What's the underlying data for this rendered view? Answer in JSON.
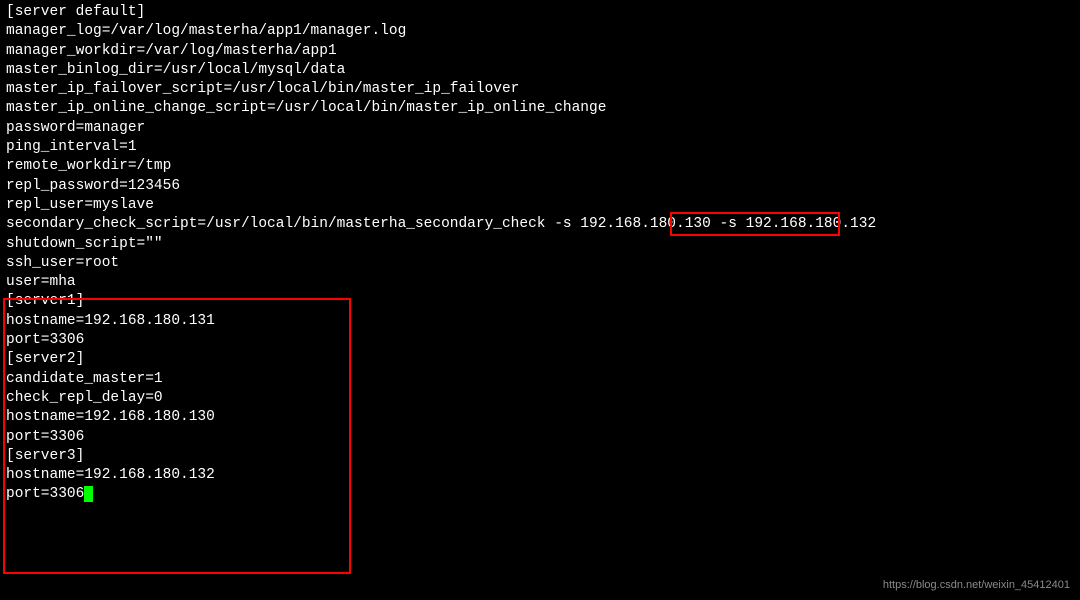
{
  "config": {
    "server_default_header": "[server default]",
    "manager_log": "manager_log=/var/log/masterha/app1/manager.log",
    "manager_workdir": "manager_workdir=/var/log/masterha/app1",
    "master_binlog_dir": "master_binlog_dir=/usr/local/mysql/data",
    "master_ip_failover_script": "master_ip_failover_script=/usr/local/bin/master_ip_failover",
    "master_ip_online_change_script": "master_ip_online_change_script=/usr/local/bin/master_ip_online_change",
    "password": "password=manager",
    "ping_interval": "ping_interval=1",
    "remote_workdir": "remote_workdir=/tmp",
    "repl_password": "repl_password=123456",
    "repl_user": "repl_user=myslave",
    "secondary_check_script": "secondary_check_script=/usr/local/bin/masterha_secondary_check -s 192.168.180.130 -s 192.168.180.132",
    "shutdown_script": "shutdown_script=\"\"",
    "ssh_user": "ssh_user=root",
    "user": "user=mha",
    "blank1": "",
    "server1_header": "[server1]",
    "server1_hostname": "hostname=192.168.180.131",
    "server1_port": "port=3306",
    "blank2": "",
    "server2_header": "[server2]",
    "server2_candidate": "candidate_master=1",
    "server2_check_delay": "check_repl_delay=0",
    "server2_hostname": "hostname=192.168.180.130",
    "server2_port": "port=3306",
    "blank3": "",
    "server3_header": "[server3]",
    "server3_hostname": "hostname=192.168.180.132",
    "server3_port_prefix": "port=3306"
  },
  "watermark": "https://blog.csdn.net/weixin_45412401"
}
